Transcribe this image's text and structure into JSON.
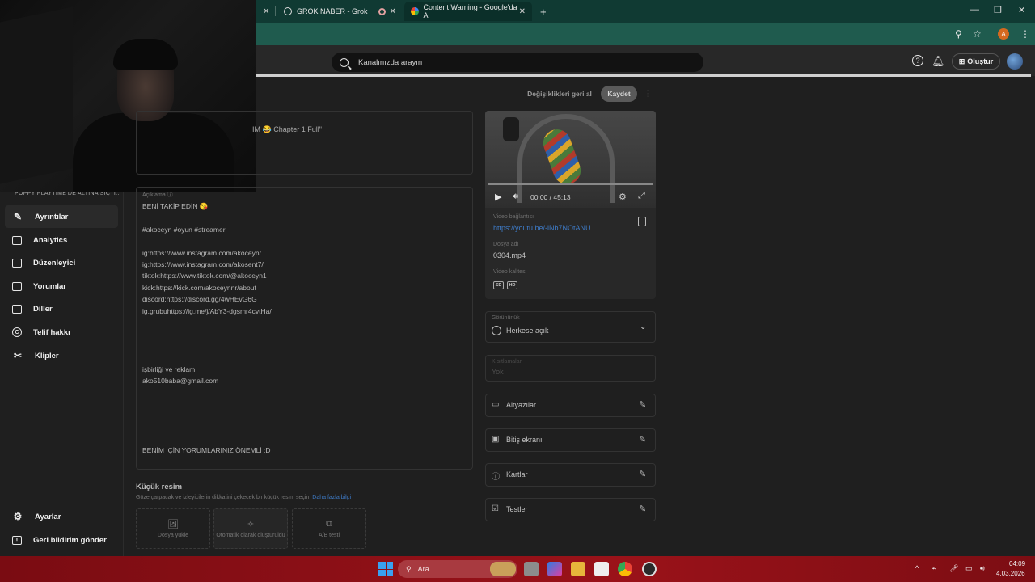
{
  "browser": {
    "tabs": [
      {
        "title": "GROK NABER - Grok"
      },
      {
        "title": ""
      },
      {
        "title": "Content Warning - Google'da A"
      }
    ],
    "new_tab": "+",
    "window_controls": [
      "—",
      "❐",
      "✕"
    ],
    "profile_initial": "A"
  },
  "header": {
    "search_placeholder": "Kanalınızda arayın",
    "create_label": "Oluştur"
  },
  "sidebar": {
    "video_title": "POPPY PLAYTIME'DE ALTINA SIÇTI...",
    "items": [
      {
        "label": "Ayrıntılar",
        "icon": "pencil-icon"
      },
      {
        "label": "Analytics",
        "icon": "analytics-icon"
      },
      {
        "label": "Düzenleyici",
        "icon": "editor-icon"
      },
      {
        "label": "Yorumlar",
        "icon": "comments-icon"
      },
      {
        "label": "Diller",
        "icon": "subtitles-icon"
      },
      {
        "label": "Telif hakkı",
        "icon": "copyright-icon"
      },
      {
        "label": "Klipler",
        "icon": "scissors-icon"
      }
    ],
    "bottom_items": [
      {
        "label": "Ayarlar",
        "icon": "gear-icon"
      },
      {
        "label": "Geri bildirim gönder",
        "icon": "feedback-icon"
      }
    ]
  },
  "actions": {
    "undo_label": "Değişiklikleri geri al",
    "save_label": "Kaydet"
  },
  "details": {
    "title_fragment": "IM 😂 Chapter 1 Full\"",
    "description_label": "Açıklama",
    "description_lines": [
      "BENİ TAKİP EDİN 😘",
      "#akoceyn #oyun #streamer",
      "ig:https://www.instagram.com/akoceyn/",
      "ig:https://www.instagram.com/akosent7/",
      "tiktok:https://www.tiktok.com/@akoceyn1",
      "kick:https://kick.com/akoceynnr/about",
      "discord:https://discord.gg/4wHEvG6G",
      "ig.grubuhttps://ig.me/j/AbY3-dgsmr4cvtHa/",
      "işbirliği ve reklam",
      "ako510baba@gmail.com",
      "BENİM İÇİN YORUMLARINIZ ÖNEMLİ :D"
    ]
  },
  "thumbnail": {
    "title": "Küçük resim",
    "subtitle": "Göze çarpacak ve izleyicilerin dikkatini çekecek bir küçük resim seçin.",
    "link": "Daha fazla bilgi",
    "options": [
      "Dosya yükle",
      "Otomatik olarak oluşturuldu",
      "A/B testi"
    ]
  },
  "video": {
    "time": "00:00 / 45:13",
    "link_label": "Video bağlantısı",
    "link_value": "https://youtu.be/-iNb7NOtANU",
    "file_label": "Dosya adı",
    "file_value": "0304.mp4",
    "quality_label": "Video kalitesi",
    "quality_badges": [
      "SD",
      "HD"
    ]
  },
  "visibility": {
    "label": "Görünürlük",
    "value": "Herkese açık"
  },
  "restrictions": {
    "label": "Kısıtlamalar",
    "value": "Yok"
  },
  "rows": [
    {
      "label": "Altyazılar",
      "icon": "subtitles-icon"
    },
    {
      "label": "Bitiş ekranı",
      "icon": "end-screen-icon"
    },
    {
      "label": "Kartlar",
      "icon": "info-icon"
    },
    {
      "label": "Testler",
      "icon": "checkbox-icon"
    }
  ],
  "taskbar": {
    "search_placeholder": "Ara",
    "time": "04:09",
    "date": "4.03.2026"
  }
}
